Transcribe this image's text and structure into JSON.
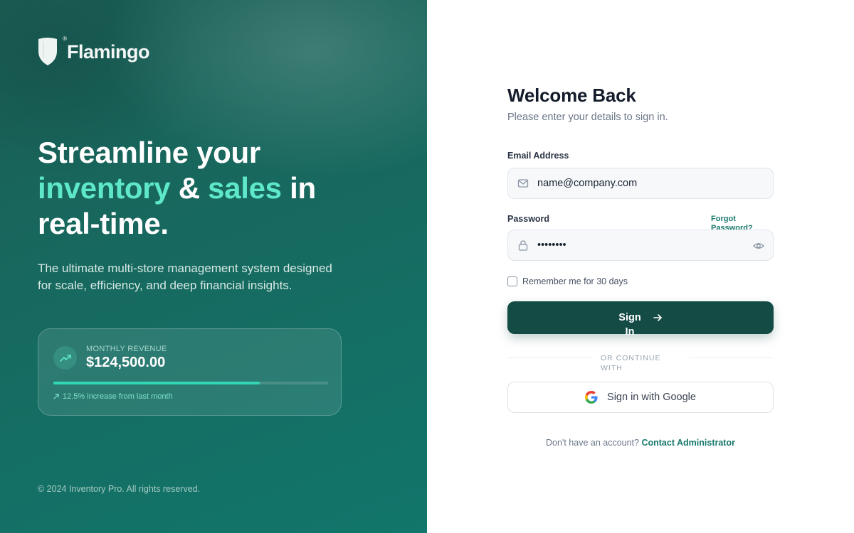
{
  "brand": {
    "name": "Flamingo",
    "registered_mark": "®"
  },
  "hero": {
    "headline_part1": "Streamline your",
    "headline_accent1": "inventory",
    "headline_amp": " & ",
    "headline_accent2": "sales",
    "headline_part2": " in",
    "headline_part3": "real-time.",
    "subtitle": "The ultimate multi-store management system designed for scale, efficiency, and deep financial insights."
  },
  "revenue_card": {
    "label": "MONTHLY REVENUE",
    "value": "$124,500.00",
    "progress_fraction": 0.75,
    "note": "12.5% increase from last month"
  },
  "copyright": "© 2024 Inventory Pro. All rights reserved.",
  "login": {
    "title": "Welcome Back",
    "description": "Please enter your details to sign in.",
    "email_label": "Email Address",
    "email_value": "name@company.com",
    "password_label": "Password",
    "password_value": "••••••••",
    "forgot_label": "Forgot Password?",
    "remember_label": "Remember me for 30 days",
    "remember_checked": false,
    "signin_label": "Sign In",
    "divider_text": "OR CONTINUE WITH",
    "google_label": "Sign in with Google",
    "footer_text": "Don't have an account?",
    "footer_link": "Contact Administrator"
  },
  "colors": {
    "accent_mint": "#5ee8c9",
    "primary_dark_green": "#144b45",
    "link_green": "#17786b",
    "progress_fill": "#33d6b5"
  },
  "icons": {
    "logo": "shield-icon",
    "revenue": "trending-up-icon",
    "note": "arrow-up-right-icon",
    "email": "mail-icon",
    "password": "lock-icon",
    "toggle_visibility": "eye-icon",
    "signin": "arrow-right-icon",
    "google": "google-icon"
  }
}
